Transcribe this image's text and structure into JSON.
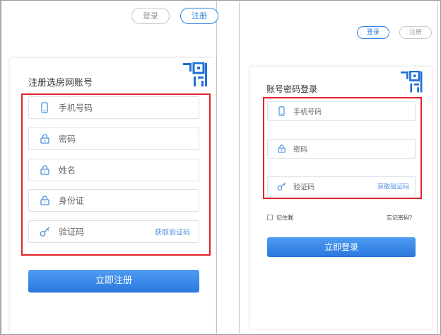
{
  "register": {
    "top_buttons": {
      "login": "登录",
      "register": "注册"
    },
    "title": "注册选房网账号",
    "fields": [
      {
        "icon": "phone-icon",
        "label": "手机号码"
      },
      {
        "icon": "lock-icon",
        "label": "密码"
      },
      {
        "icon": "lock-icon",
        "label": "姓名"
      },
      {
        "icon": "lock-icon",
        "label": "身份证"
      },
      {
        "icon": "key-icon",
        "label": "验证码",
        "link": "获取验证码"
      }
    ],
    "submit": "立即注册"
  },
  "login": {
    "top_buttons": {
      "login": "登录",
      "register": "注册"
    },
    "title": "账号密码登录",
    "fields": [
      {
        "icon": "phone-icon",
        "label": "手机号码"
      },
      {
        "icon": "lock-icon",
        "label": "密码"
      },
      {
        "icon": "key-icon",
        "label": "验证码",
        "link": "获取验证码"
      }
    ],
    "remember": "记住我",
    "forgot": "忘记密码?",
    "submit": "立即登录"
  },
  "colors": {
    "accent": "#2f80e1",
    "highlight": "#e4222b",
    "button": "#3a8ae8"
  }
}
